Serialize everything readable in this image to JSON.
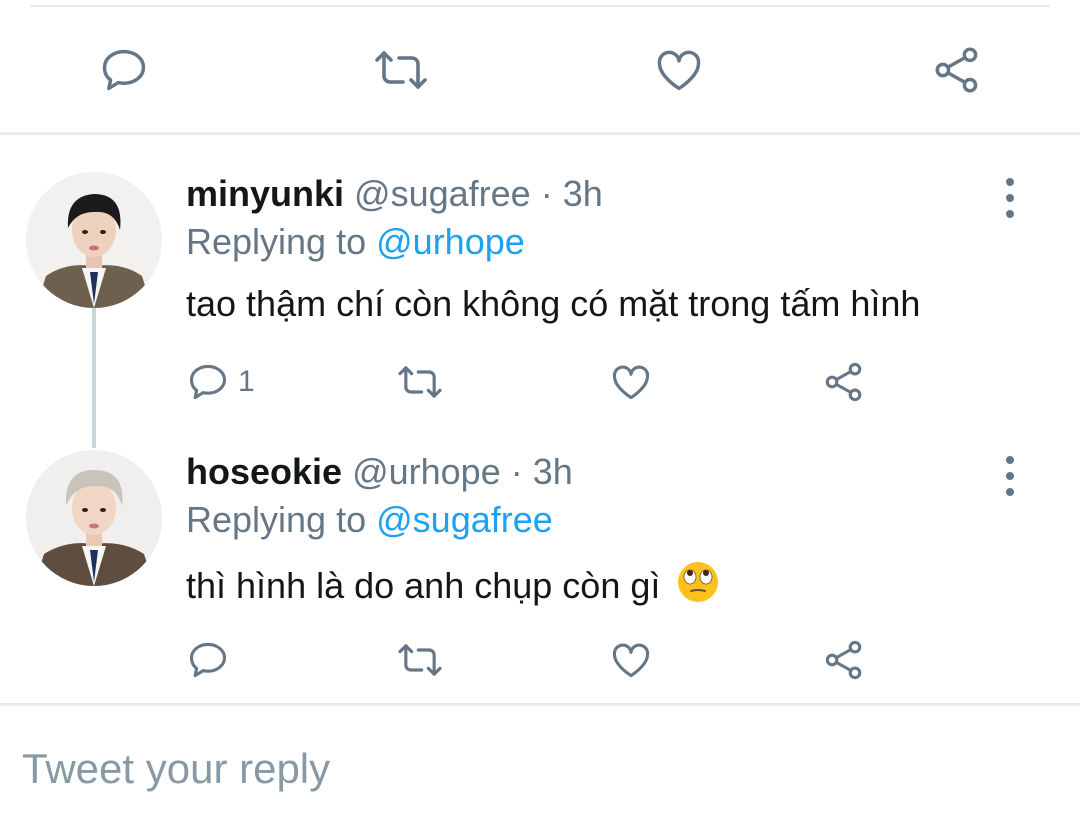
{
  "top_actions": {
    "icons": [
      "reply-icon",
      "retweet-icon",
      "like-icon",
      "share-icon"
    ]
  },
  "replies": [
    {
      "display_name": "minyunki",
      "handle": "@sugafree",
      "separator": "·",
      "time": "3h",
      "replying_prefix": "Replying to",
      "replying_to": "@urhope",
      "text": "tao thậm chí còn không có mặt trong tấm hình",
      "reply_count": "1",
      "avatar_hair_color": "#1c1a1e",
      "avatar_jacket_color": "#6e604f"
    },
    {
      "display_name": "hoseokie",
      "handle": "@urhope",
      "separator": "·",
      "time": "3h",
      "replying_prefix": "Replying to",
      "replying_to": "@sugafree",
      "text": "thì hình là do anh chụp còn gì",
      "emoji": "face-with-rolling-eyes-emoji",
      "reply_count": "",
      "avatar_hair_color": "#c9c4bb",
      "avatar_jacket_color": "#5f4d3f"
    }
  ],
  "compose": {
    "placeholder": "Tweet your reply"
  },
  "colors": {
    "accent": "#1da1f2",
    "secondary_text": "#657786",
    "divider": "#e6ecf0"
  }
}
